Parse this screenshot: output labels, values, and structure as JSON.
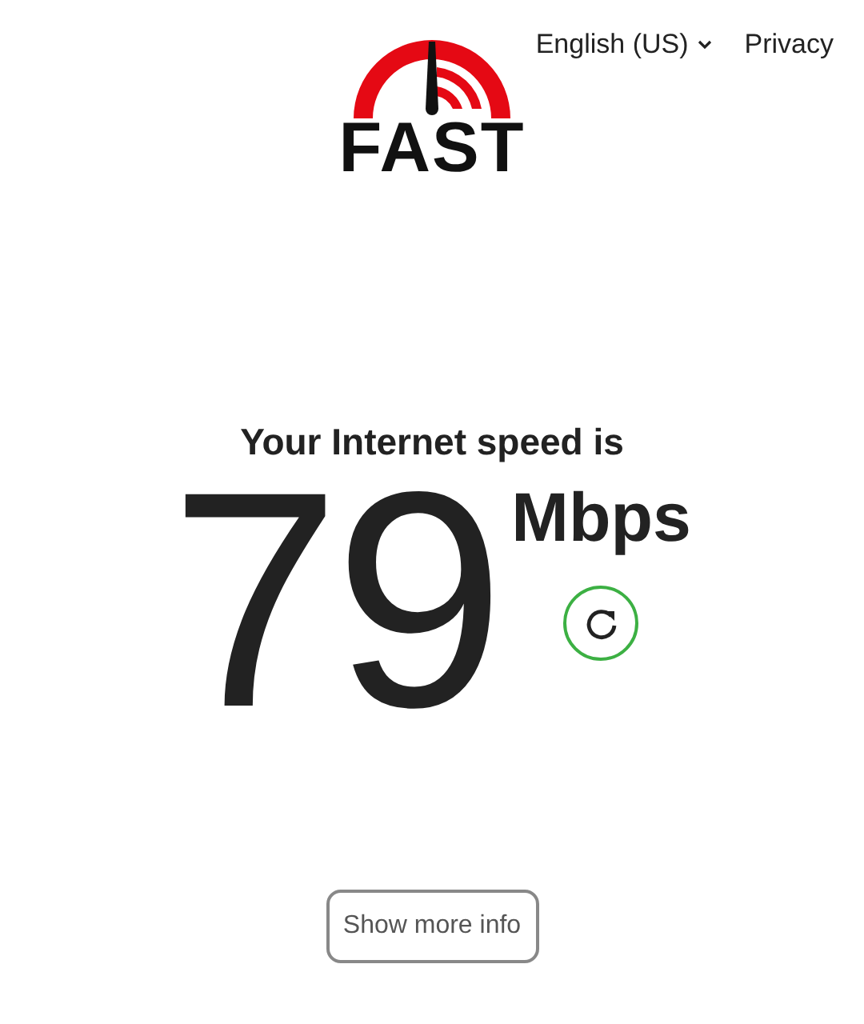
{
  "header": {
    "logo": {
      "text": "FAST"
    },
    "nav": [
      {
        "kind": "dropdown",
        "label": "English (US)"
      },
      {
        "kind": "link",
        "label": "Privacy"
      }
    ]
  },
  "result": {
    "heading": "Your Internet speed is",
    "speed": "79",
    "unit": "Mbps"
  },
  "more_info_button": {
    "label": "Show more info"
  }
}
